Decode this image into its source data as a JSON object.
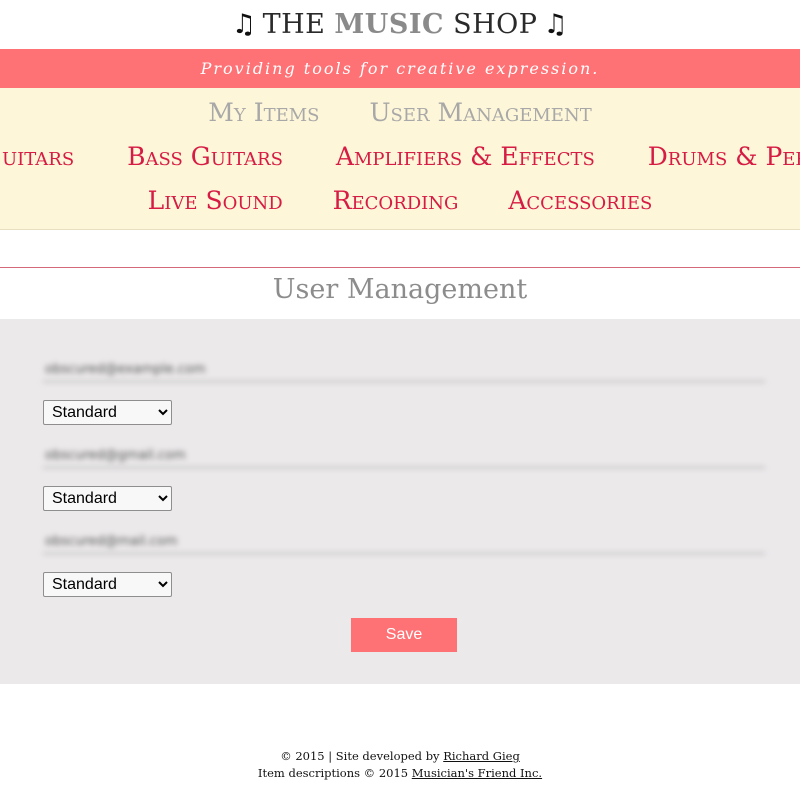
{
  "header": {
    "note_left": "♫",
    "title_the": "THE",
    "title_music": "MUSIC",
    "title_shop": "SHOP",
    "note_right": "♫"
  },
  "tagline": "Providing tools for creative expression.",
  "nav": {
    "top": [
      "My Items",
      "User Management"
    ],
    "mid": [
      "Guitars",
      "Bass Guitars",
      "Amplifiers & Effects",
      "Drums & Percussion"
    ],
    "bottom": [
      "Live Sound",
      "Recording",
      "Accessories"
    ]
  },
  "page_title": "User Management",
  "users": [
    {
      "email": "obscured@example.com",
      "role": "Standard"
    },
    {
      "email": "obscured@gmail.com",
      "role": "Standard"
    },
    {
      "email": "obscured@mail.com",
      "role": "Standard"
    }
  ],
  "role_options": [
    "Standard"
  ],
  "save_label": "Save",
  "footer": {
    "line1_prefix": "© 2015 | Site developed by ",
    "developer": "Richard Gieg",
    "line2_prefix": "Item descriptions © 2015 ",
    "source": "Musician's Friend Inc."
  },
  "colors": {
    "accent": "#fe7276",
    "nav_background": "#fef6d8",
    "nav_link": "#d61b44",
    "panel_background": "#ebe9ea"
  }
}
